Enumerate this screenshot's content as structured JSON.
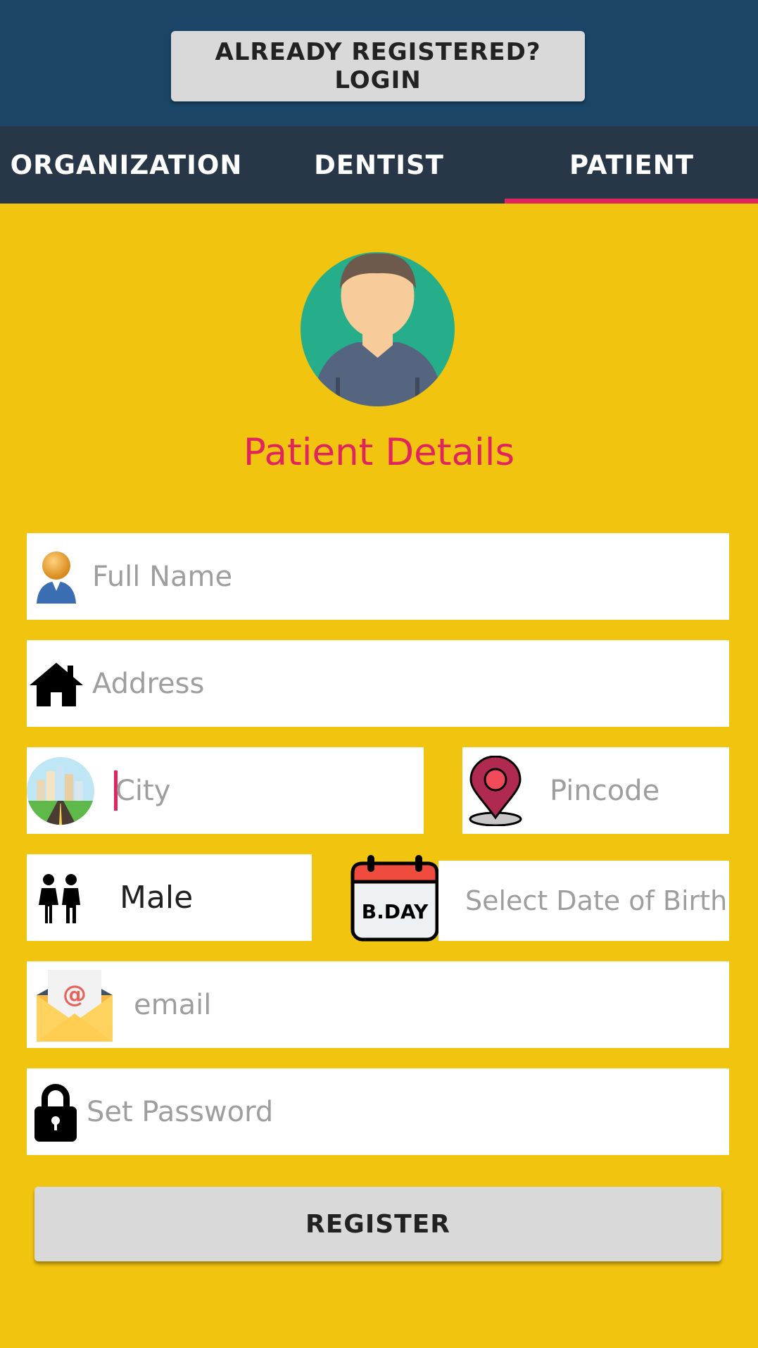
{
  "header": {
    "login_button_label": "ALREADY REGISTERED? LOGIN"
  },
  "tabs": [
    {
      "label": "ORGANIZATION",
      "selected": false
    },
    {
      "label": "DENTIST",
      "selected": false
    },
    {
      "label": "PATIENT",
      "selected": true
    }
  ],
  "colors": {
    "header_bg": "#1A4566",
    "tabbar_bg": "#283747",
    "accent": "#E0245E",
    "page_bg": "#F1C40F"
  },
  "form": {
    "title": "Patient Details",
    "avatar_icon": "patient-avatar-icon",
    "full_name": {
      "placeholder": "Full Name",
      "value": "",
      "icon": "person-icon"
    },
    "address": {
      "placeholder": "Address",
      "value": "",
      "icon": "house-icon"
    },
    "city": {
      "placeholder": "City",
      "value": "",
      "icon": "city-road-icon",
      "focused": true
    },
    "pincode": {
      "placeholder": "Pincode",
      "value": "",
      "icon": "location-pin-icon"
    },
    "gender": {
      "value": "Male",
      "icon": "people-icon"
    },
    "dob": {
      "placeholder": "Select Date of Birth",
      "icon": "birthday-calendar-icon",
      "calendar_label": "B.DAY"
    },
    "email": {
      "placeholder": "email",
      "value": "",
      "icon": "email-envelope-icon"
    },
    "password": {
      "placeholder": "Set Password",
      "value": "",
      "icon": "padlock-icon"
    },
    "register_label": "REGISTER"
  }
}
